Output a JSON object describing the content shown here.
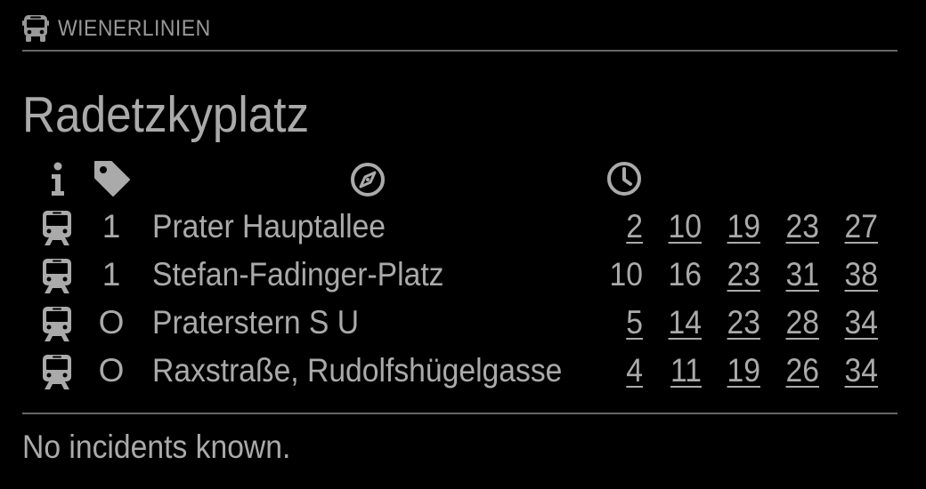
{
  "header": {
    "title": "WIENERLINIEN",
    "icon": "bus-icon"
  },
  "station": "Radetzkyplatz",
  "columns": {
    "info_icon": "info-icon",
    "line_icon": "tag-icon",
    "direction_icon": "compass-icon",
    "time_icon": "clock-icon"
  },
  "departures": [
    {
      "type_icon": "tram-icon",
      "line": "1",
      "towards": "Prater Hauptallee",
      "times": [
        "2",
        "10",
        "19",
        "23",
        "27"
      ],
      "realtime": [
        true,
        true,
        true,
        true,
        true
      ]
    },
    {
      "type_icon": "tram-icon",
      "line": "1",
      "towards": "Stefan-Fadinger-Platz",
      "times": [
        "10",
        "16",
        "23",
        "31",
        "38"
      ],
      "realtime": [
        false,
        false,
        true,
        true,
        true
      ]
    },
    {
      "type_icon": "tram-icon",
      "line": "O",
      "towards": "Praterstern S U",
      "times": [
        "5",
        "14",
        "23",
        "28",
        "34"
      ],
      "realtime": [
        true,
        true,
        true,
        true,
        true
      ]
    },
    {
      "type_icon": "tram-icon",
      "line": "O",
      "towards": "Raxstraße, Rudolfshügelgasse",
      "times": [
        "4",
        "11",
        "19",
        "26",
        "34"
      ],
      "realtime": [
        true,
        true,
        true,
        true,
        true
      ]
    }
  ],
  "incidents": "No incidents known.",
  "colors": {
    "background": "#000000",
    "text": "#aaaaaa",
    "rule": "#666666"
  }
}
